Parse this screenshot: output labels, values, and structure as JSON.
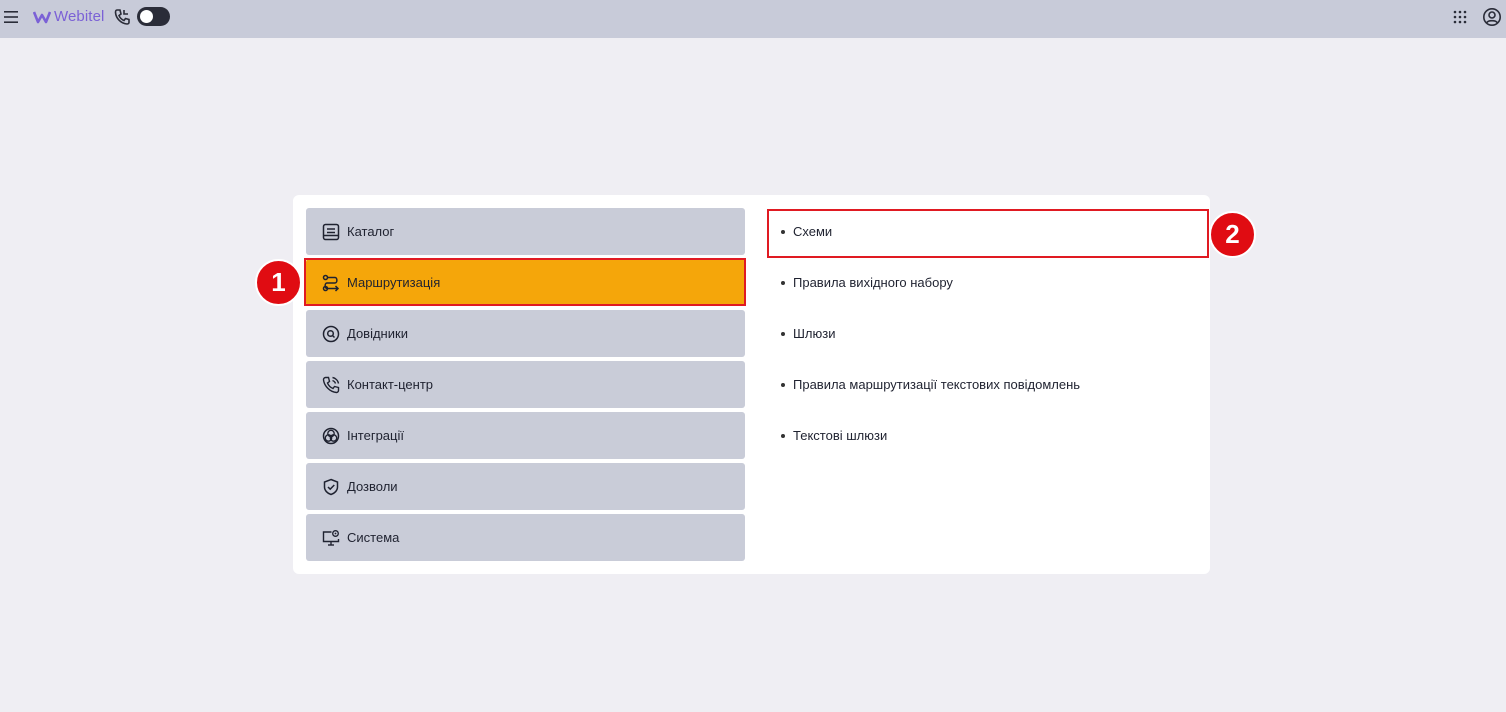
{
  "header": {
    "logo_text": "Webitel",
    "brand_color": "#7b61d6",
    "toggle_state": "off",
    "icons": [
      "menu-icon",
      "webitel-logo-icon",
      "phone-icon",
      "apps-grid-icon",
      "account-icon"
    ]
  },
  "sections": [
    {
      "label": "Каталог",
      "icon": "catalog-icon",
      "active": false
    },
    {
      "label": "Маршрутизація",
      "icon": "routing-icon",
      "active": true
    },
    {
      "label": "Довідники",
      "icon": "directory-icon",
      "active": false
    },
    {
      "label": "Контакт-центр",
      "icon": "contact-center-icon",
      "active": false
    },
    {
      "label": "Інтеграції",
      "icon": "integrations-icon",
      "active": false
    },
    {
      "label": "Дозволи",
      "icon": "permissions-icon",
      "active": false
    },
    {
      "label": "Система",
      "icon": "system-icon",
      "active": false
    }
  ],
  "subitems": [
    {
      "label": "Схеми"
    },
    {
      "label": "Правила вихідного набору"
    },
    {
      "label": "Шлюзи"
    },
    {
      "label": "Правила маршрутизації текстових повідомлень"
    },
    {
      "label": "Текстові шлюзи"
    }
  ],
  "annotations": [
    {
      "number": "1"
    },
    {
      "number": "2"
    }
  ],
  "colors": {
    "active_section": "#f5a60a",
    "section_bg": "#c9ccd8",
    "highlight": "#e01a22",
    "badge": "#e00c12"
  }
}
